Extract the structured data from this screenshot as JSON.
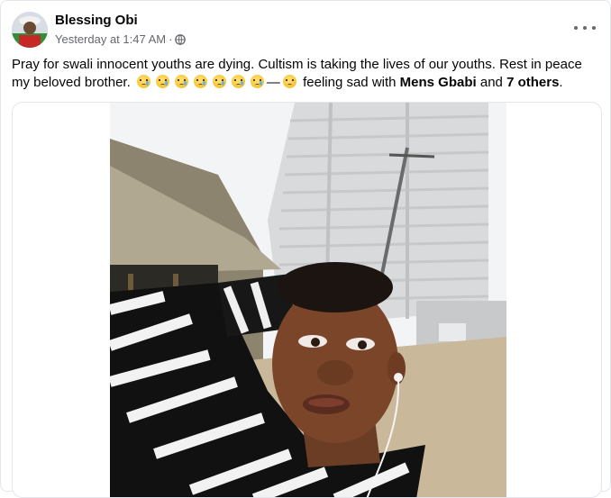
{
  "post": {
    "author_name": "Blessing Obi",
    "timestamp": "Yesterday at 1:47 AM",
    "separator": "·",
    "privacy_icon": "globe-icon",
    "more_icon": "more-options-icon",
    "text_main": "Pray for swali innocent youths are dying. Cultism is taking the lives of our youths.     Rest in peace my beloved  brother.",
    "emojis": [
      "crying-face",
      "crying-face",
      "crying-face",
      "crying-face",
      "crying-face",
      "crying-face",
      "crying-face",
      "sad-face"
    ],
    "dash": "—",
    "feeling_text": "feeling sad with",
    "tagged_person": "Mens Gbabi",
    "and_text": "and",
    "others_text": "7 others",
    "end_period": "."
  },
  "colors": {
    "text_primary": "#050505",
    "text_secondary": "#65676b",
    "border": "#e4e6eb"
  }
}
